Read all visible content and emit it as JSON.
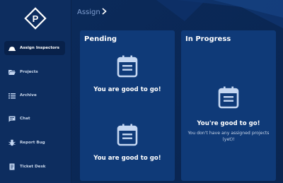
{
  "sidebar": {
    "items": [
      {
        "label": "Assign Inspectors",
        "icon": "hard-hat-icon",
        "active": true
      },
      {
        "label": "Projects",
        "icon": "folder-open-icon",
        "active": false
      },
      {
        "label": "Archive",
        "icon": "list-icon",
        "active": false
      },
      {
        "label": "Chat",
        "icon": "chat-icon",
        "active": false
      },
      {
        "label": "Report Bug",
        "icon": "bug-icon",
        "active": false
      },
      {
        "label": "Ticket Desk",
        "icon": "ticket-icon",
        "active": false
      }
    ]
  },
  "header": {
    "breadcrumb": "Assign",
    "chevron": "chevron-right-icon"
  },
  "pending": {
    "title": "Pending",
    "messages": [
      "You are good to go!",
      "You are good to go!"
    ]
  },
  "in_progress": {
    "title": "In Progress",
    "message": "You're good to go!",
    "submessage": "You don't have any assigned projects (yet)!"
  },
  "colors": {
    "sidebar": "#0d2d5f",
    "card": "#0f3a78",
    "active_nav": "#08214a",
    "breadcrumb": "#7f9ed0",
    "icon_light": "#c5d7f2"
  }
}
